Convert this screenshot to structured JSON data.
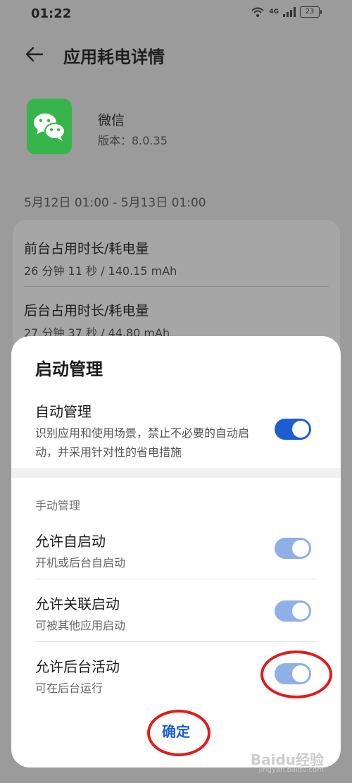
{
  "status_bar": {
    "time": "01:22",
    "network": "4G",
    "battery": "23"
  },
  "header": {
    "title": "应用耗电详情"
  },
  "app": {
    "name": "微信",
    "version": "版本：8.0.35"
  },
  "date_range": "5月12日 01:00 - 5月13日 01:00",
  "stats": [
    {
      "title": "前台占用时长/耗电量",
      "value": "26 分钟 11 秒 / 140.15 mAh"
    },
    {
      "title": "后台占用时长/耗电量",
      "value": "27 分钟 37 秒 / 44.80 mAh"
    }
  ],
  "sheet": {
    "title": "启动管理",
    "auto": {
      "title": "自动管理",
      "desc": "识别应用和使用场景，禁止不必要的自动启动，并采用针对性的省电措施",
      "enabled": true
    },
    "manual_label": "手动管理",
    "rows": [
      {
        "title": "允许自启动",
        "sub": "开机或后台自启动",
        "enabled": true
      },
      {
        "title": "允许关联启动",
        "sub": "可被其他应用启动",
        "enabled": true
      },
      {
        "title": "允许后台活动",
        "sub": "可在后台运行",
        "enabled": true
      }
    ],
    "confirm": "确定"
  },
  "watermark": {
    "main": "Baidu经验",
    "sub": "jingyan.baidu.com"
  },
  "colors": {
    "accent": "#1d5fd2",
    "toggle_disabled": "#8fb0e6",
    "annotation": "#e21b1b",
    "wechat_green": "#37b44a"
  }
}
